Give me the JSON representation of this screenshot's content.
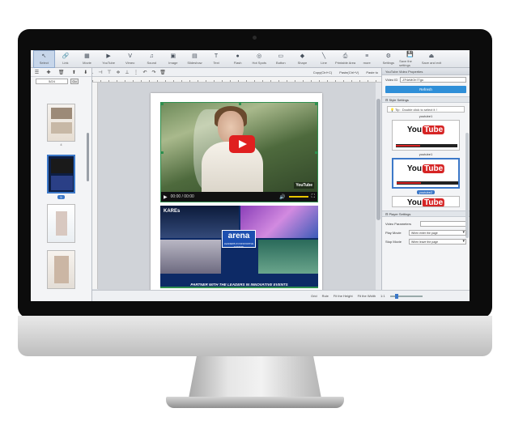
{
  "toolbar": {
    "tools": [
      {
        "label": "Select",
        "icon": "↖",
        "icon_name": "cursor-icon"
      },
      {
        "label": "Link",
        "icon": "🔗",
        "icon_name": "link-icon"
      },
      {
        "label": "Movie",
        "icon": "▦",
        "icon_name": "film-icon"
      },
      {
        "label": "YouTube",
        "icon": "▶",
        "icon_name": "youtube-icon"
      },
      {
        "label": "Vimeo",
        "icon": "V",
        "icon_name": "vimeo-icon"
      },
      {
        "label": "Sound",
        "icon": "♫",
        "icon_name": "music-icon"
      },
      {
        "label": "Image",
        "icon": "▣",
        "icon_name": "image-icon"
      },
      {
        "label": "Slideshow",
        "icon": "▤",
        "icon_name": "slideshow-icon"
      },
      {
        "label": "Text",
        "icon": "T",
        "icon_name": "text-icon"
      },
      {
        "label": "Flash",
        "icon": "●",
        "icon_name": "flash-icon"
      },
      {
        "label": "Hot Spots",
        "icon": "◎",
        "icon_name": "hotspot-icon"
      },
      {
        "label": "Button",
        "icon": "▭",
        "icon_name": "button-icon"
      },
      {
        "label": "Shape",
        "icon": "◆",
        "icon_name": "shape-icon"
      },
      {
        "label": "Line",
        "icon": "╲",
        "icon_name": "line-icon"
      },
      {
        "label": "Printable Area",
        "icon": "⎙",
        "icon_name": "printer-icon"
      },
      {
        "label": "more",
        "icon": "≡",
        "icon_name": "more-icon"
      },
      {
        "label": "Settings",
        "icon": "⚙",
        "icon_name": "gear-icon"
      },
      {
        "label": "Save the settings",
        "icon": "💾",
        "icon_name": "save-icon"
      },
      {
        "label": "Save and exit",
        "icon": "⏏",
        "icon_name": "save-exit-icon"
      }
    ]
  },
  "edit_bar": {
    "copy": "Copy(Ctrl+C)",
    "paste": "Paste(Ctrl+V)",
    "paste_to": "Paste to"
  },
  "pages": {
    "current": "5/24",
    "go": "Go",
    "labels": [
      "4",
      "5"
    ]
  },
  "video": {
    "time": "00:00 / 00:00",
    "watermark": "YouTube"
  },
  "ad": {
    "brand_small": "KAREs",
    "logo": "arena",
    "logo_sub": "LEADERS IN INNOVATIVE EVENTS",
    "tagline": "PARTNER WITH THE LEADERS IN INNOVATIVE EVENTS"
  },
  "statusbar": {
    "grid": "Grid",
    "rule": "Rule",
    "fit_height": "Fit the Height",
    "fit_width": "Fit the Width",
    "zoom": "1:1"
  },
  "right_panel": {
    "title": "YouTube Video Properties",
    "video_id_label": "Video ID",
    "video_id": "ZF4eMOh7Tgo",
    "refresh": "Refresh",
    "style_section": "Style Settings",
    "tip": "Tip : Double click to select it !",
    "style_labels": [
      "youtube1",
      "youtube1",
      "youtube2"
    ],
    "player_section": "Player Settings",
    "video_params_label": "Video Parameters",
    "play_movie_label": "Play Movie",
    "play_movie_value": "When enter the page",
    "stop_movie_label": "Stop Movie",
    "stop_movie_value": "When leave the page"
  }
}
